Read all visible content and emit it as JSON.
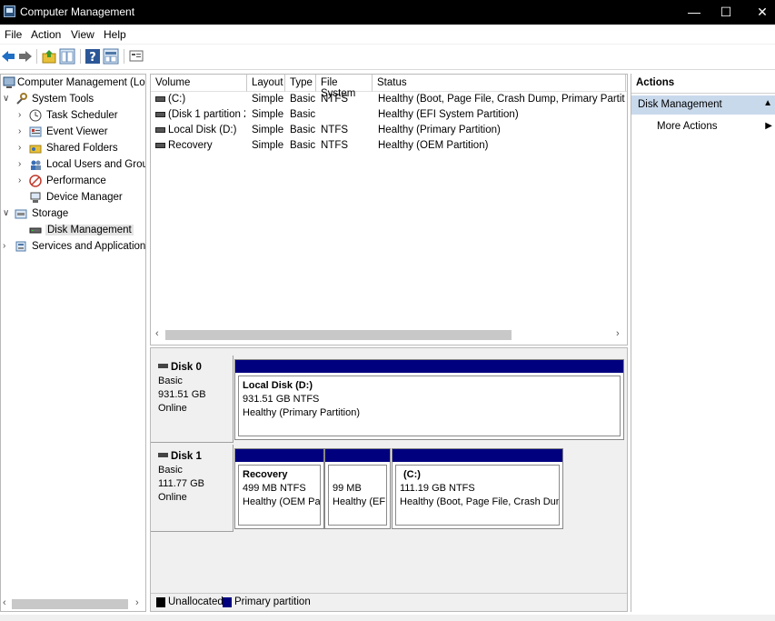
{
  "window": {
    "title": "Computer Management",
    "minimize": "—",
    "maximize": "☐",
    "close": "✕"
  },
  "menu": [
    "File",
    "Action",
    "View",
    "Help"
  ],
  "tree": {
    "root": "Computer Management (Local",
    "system_tools": "System Tools",
    "items": [
      "Task Scheduler",
      "Event Viewer",
      "Shared Folders",
      "Local Users and Groups",
      "Performance",
      "Device Manager"
    ],
    "storage": "Storage",
    "disk_management": "Disk Management",
    "services": "Services and Applications"
  },
  "volume_list": {
    "columns": [
      "Volume",
      "Layout",
      "Type",
      "File System",
      "Status"
    ],
    "rows": [
      {
        "volume": "(C:)",
        "layout": "Simple",
        "type": "Basic",
        "fs": "NTFS",
        "status": "Healthy (Boot, Page File, Crash Dump, Primary Partition)"
      },
      {
        "volume": "(Disk 1 partition 2)",
        "layout": "Simple",
        "type": "Basic",
        "fs": "",
        "status": "Healthy (EFI System Partition)"
      },
      {
        "volume": "Local Disk (D:)",
        "layout": "Simple",
        "type": "Basic",
        "fs": "NTFS",
        "status": "Healthy (Primary Partition)"
      },
      {
        "volume": "Recovery",
        "layout": "Simple",
        "type": "Basic",
        "fs": "NTFS",
        "status": "Healthy (OEM Partition)"
      }
    ]
  },
  "disks": [
    {
      "name": "Disk 0",
      "kind": "Basic",
      "size": "931.51 GB",
      "state": "Online",
      "partitions": [
        {
          "name": "Local Disk  (D:)",
          "size": "931.51 GB NTFS",
          "status": "Healthy (Primary Partition)"
        }
      ]
    },
    {
      "name": "Disk 1",
      "kind": "Basic",
      "size": "111.77 GB",
      "state": "Online",
      "partitions": [
        {
          "name": "Recovery",
          "size": "499 MB NTFS",
          "status": "Healthy (OEM Part"
        },
        {
          "name": "",
          "size": "99 MB",
          "status": "Healthy (EFI S"
        },
        {
          "name": "(C:)",
          "size": "111.19 GB NTFS",
          "status": "Healthy (Boot, Page File, Crash Dump,"
        }
      ]
    }
  ],
  "legend": [
    {
      "label": "Unallocated",
      "color": "#000000"
    },
    {
      "label": "Primary partition",
      "color": "#00007f"
    }
  ],
  "actions": {
    "title": "Actions",
    "section": "Disk Management",
    "item": "More Actions"
  },
  "icons": [
    "back-arrow-icon",
    "forward-arrow-icon",
    "up-folder-icon",
    "show-hide-tree-icon",
    "help-icon",
    "properties-icon",
    "export-icon"
  ]
}
